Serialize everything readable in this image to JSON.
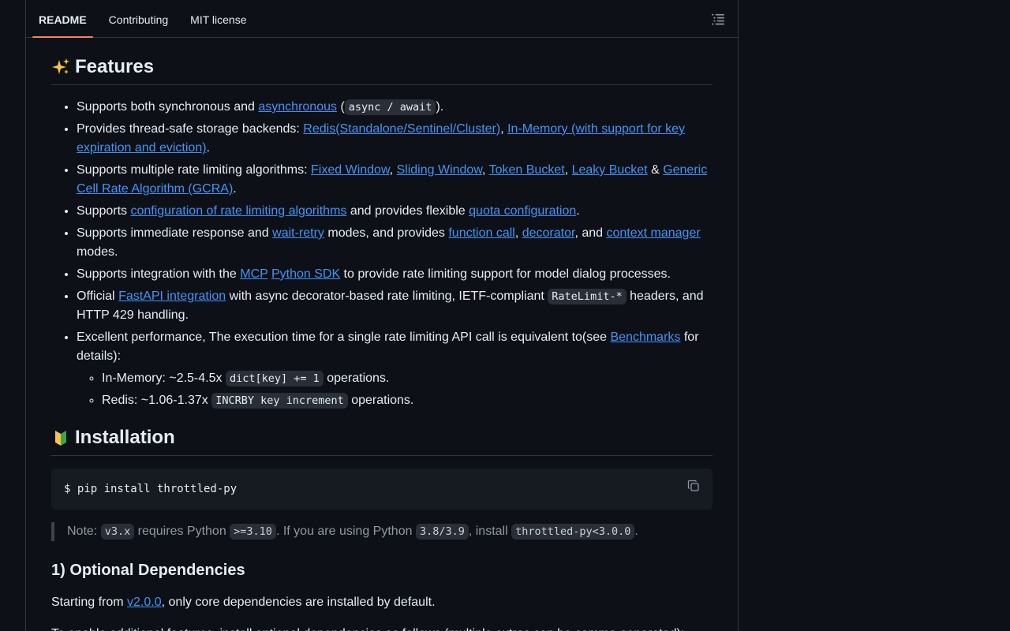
{
  "tabs": [
    {
      "label": "README",
      "active": true
    },
    {
      "label": "Contributing",
      "active": false
    },
    {
      "label": "MIT license",
      "active": false
    }
  ],
  "outline_icon": "list-unordered-icon",
  "features": {
    "emoji": "sparkles",
    "title": "Features",
    "items": {
      "i1": {
        "t1": "Supports both synchronous and ",
        "link": "asynchronous",
        "t2": " (",
        "code": "async / await",
        "t3": ")."
      },
      "i2": {
        "t1": "Provides thread-safe storage backends: ",
        "link1": "Redis(Standalone/Sentinel/Cluster)",
        "t2": ", ",
        "link2": "In-Memory (with support for key expiration and eviction)",
        "t3": "."
      },
      "i3": {
        "t1": "Supports multiple rate limiting algorithms: ",
        "l1": "Fixed Window",
        "l2": "Sliding Window",
        "l3": "Token Bucket",
        "l4": "Leaky Bucket",
        "amp": " & ",
        "l5": "Generic Cell Rate Algorithm (GCRA)",
        "t2": "."
      },
      "i4": {
        "t1": "Supports ",
        "l1": "configuration of rate limiting algorithms",
        "t2": " and provides flexible ",
        "l2": "quota configuration",
        "t3": "."
      },
      "i5": {
        "t1": "Supports immediate response and ",
        "l1": "wait-retry",
        "t2": " modes, and provides ",
        "l2": "function call",
        "l3": "decorator",
        "t3": ", and ",
        "l4": "context manager",
        "t4": " modes."
      },
      "i6": {
        "t1": "Supports integration with the ",
        "l1": "MCP",
        "l2": "Python SDK",
        "t2": " to provide rate limiting support for model dialog processes."
      },
      "i7": {
        "t1": "Official ",
        "l1": "FastAPI integration",
        "t2": " with async decorator-based rate limiting, IETF-compliant ",
        "code": "RateLimit-*",
        "t3": " headers, and HTTP 429 handling."
      },
      "i8": {
        "t1": "Excellent performance, The execution time for a single rate limiting API call is equivalent to(see ",
        "l1": "Benchmarks",
        "t2": " for details):",
        "sub1": {
          "t1": "In-Memory: ~2.5-4.5x ",
          "code": "dict[key] += 1",
          "t2": " operations."
        },
        "sub2": {
          "t1": "Redis: ~1.06-1.37x ",
          "code": "INCRBY key increment",
          "t2": " operations."
        }
      }
    }
  },
  "installation": {
    "emoji": "japanese-beginner-symbol",
    "title": "Installation",
    "command": "$ pip install throttled-py",
    "copy_icon": "copy-icon",
    "note": {
      "t1": "Note: ",
      "c1": "v3.x",
      "t2": " requires Python ",
      "c2": ">=3.10",
      "t3": ". If you are using Python ",
      "c3": "3.8/3.9",
      "t4": ", install ",
      "c4": "throttled-py<3.0.0",
      "t5": "."
    }
  },
  "optional": {
    "title": "1) Optional Dependencies",
    "p1": {
      "t1": "Starting from ",
      "link": "v2.0.0",
      "t2": ", only core dependencies are installed by default."
    },
    "p2_partial": "To enable additional features, install optional dependencies as follows (multiple extras can be comma-separated):"
  },
  "colors": {
    "bg": "#0d1117",
    "text": "#e6edf3",
    "link": "#4493f8",
    "border": "#30363d",
    "tab_underline": "#f78166"
  }
}
